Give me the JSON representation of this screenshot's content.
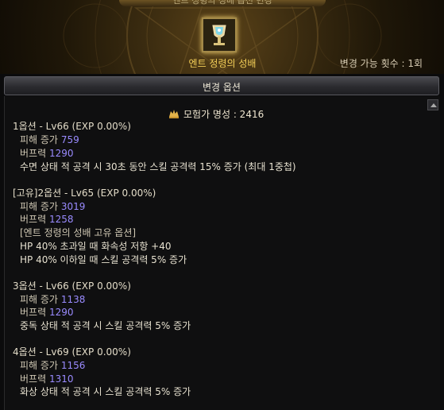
{
  "window": {
    "title": "엔트 정령의 성배 옵션 변경"
  },
  "item": {
    "name": "엔트 정령의 성배",
    "icon": "chalice-icon"
  },
  "change_count": "변경 가능 횟수 : 1회",
  "section_title": "변경 옵션",
  "fame": {
    "label": "모험가 명성 : 2416",
    "icon": "fame-icon"
  },
  "options": [
    {
      "header": "1옵션 - Lv66 (EXP 0.00%)",
      "damage_label": "피해 증가",
      "damage_value": "759",
      "buff_label": "버프력",
      "buff_value": "1290",
      "effects": [
        "수면 상태 적 공격 시 30초 동안 스킬 공격력 15% 증가 (최대 1중첩)"
      ]
    },
    {
      "header": "[고유]2옵션 - Lv65 (EXP 0.00%)",
      "damage_label": "피해 증가",
      "damage_value": "3019",
      "buff_label": "버프력",
      "buff_value": "1258",
      "effects": [
        "[엔트 정령의 성배 고유 옵션]",
        "HP 40% 초과일 때 화속성 저항 +40",
        "HP 40% 이하일 때 스킬 공격력 5% 증가"
      ]
    },
    {
      "header": "3옵션 - Lv66 (EXP 0.00%)",
      "damage_label": "피해 증가",
      "damage_value": "1138",
      "buff_label": "버프력",
      "buff_value": "1290",
      "effects": [
        "중독 상태 적 공격 시 스킬 공격력 5% 증가"
      ]
    },
    {
      "header": "4옵션 - Lv69 (EXP 0.00%)",
      "damage_label": "피해 증가",
      "damage_value": "1156",
      "buff_label": "버프력",
      "buff_value": "1310",
      "effects": [
        "화상 상태 적 공격 시 스킬 공격력 5% 증가"
      ]
    }
  ]
}
